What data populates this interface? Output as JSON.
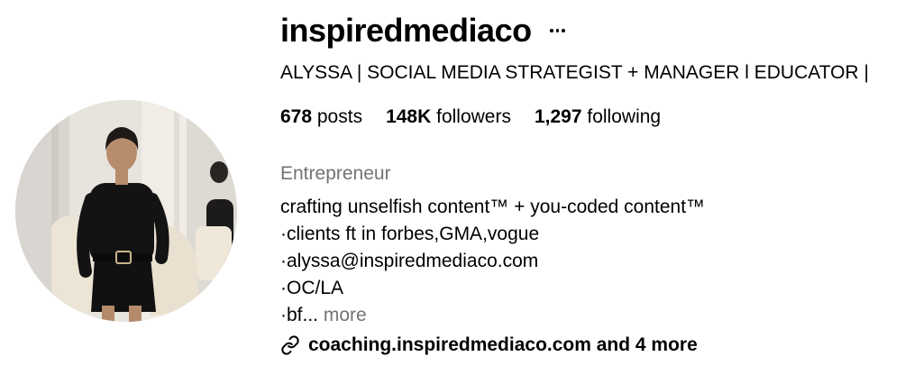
{
  "profile": {
    "username": "inspiredmediaco",
    "full_name": "ALYSSA | SOCIAL MEDIA STRATEGIST + MANAGER l EDUCATOR |",
    "stats": {
      "posts_count": "678",
      "posts_label": " posts",
      "followers_count": "148K",
      "followers_label": " followers",
      "following_count": "1,297",
      "following_label": " following"
    },
    "category": "Entrepreneur",
    "bio": {
      "line1": "crafting unselfish content™ + you-coded content™",
      "line2": "·clients ft in forbes,GMA,vogue",
      "line3": "·alyssa@inspiredmediaco.com",
      "line4": "·OC/LA",
      "line5": "·bf...",
      "more": "more"
    },
    "link": {
      "icon": "link-icon",
      "text": "coaching.inspiredmediaco.com and 4 more"
    },
    "icons": {
      "more": "more-options-icon"
    }
  }
}
